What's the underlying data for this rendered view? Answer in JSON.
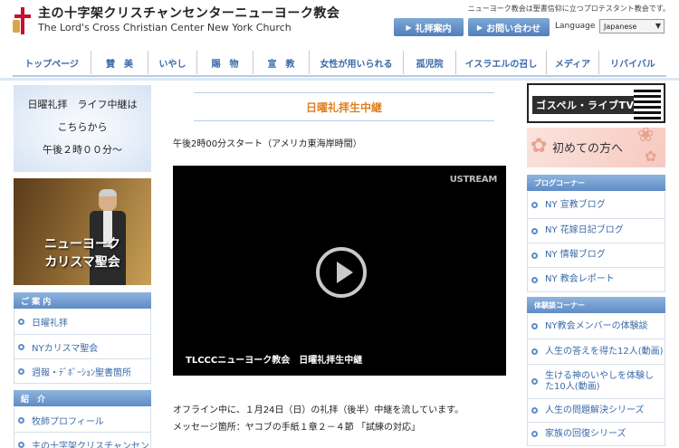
{
  "header": {
    "logo_jp": "主の十字架クリスチャンセンターニューヨーク教会",
    "logo_en": "The Lord's Cross Christian Center New York Church",
    "tagline": "ニューヨーク教会は聖書信仰に立つプロテスタント教会です。",
    "btn_worship": "礼拝案内",
    "btn_contact": "お問い合わせ",
    "language_label": "Language",
    "language_value": "Japanese",
    "arrow_icon": "▶"
  },
  "nav": {
    "items": [
      {
        "label": "トップページ"
      },
      {
        "label": "賛　美"
      },
      {
        "label": "いやし"
      },
      {
        "label": "賜　物"
      },
      {
        "label": "宣　教"
      },
      {
        "label": "女性が用いられる"
      },
      {
        "label": "孤児院"
      },
      {
        "label": "イスラエルの召し"
      },
      {
        "label": "メディア"
      },
      {
        "label": "リバイバル"
      }
    ]
  },
  "left": {
    "broadcast_lines": [
      "日曜礼拝　ライフ中継は",
      "こちらから",
      "午後２時００分～"
    ],
    "photo_caption_1": "ニューヨーク",
    "photo_caption_2": "カリスマ聖会",
    "guide_head": "ご 案 内",
    "guide_items": [
      {
        "label": "日曜礼拝"
      },
      {
        "label": "NYカリスマ聖会"
      },
      {
        "label": "週報・ﾃﾞﾎﾞｰｼｮﾝ聖書箇所"
      }
    ],
    "intro_head": "紹　介",
    "intro_items": [
      {
        "label": "牧師プロフィール"
      },
      {
        "label": "主の十字架クリスチャンセン"
      }
    ]
  },
  "main": {
    "title": "日曜礼拝生中継",
    "start_text": "午後2時00分スタート（アメリカ東海岸時間）",
    "video_brand": "USTREAM",
    "video_caption": "TLCCCニューヨーク教会　日曜礼拝生中継",
    "body_line_1": "オフライン中に、１月24日（日）の礼拝（後半）中継を流しています。",
    "body_line_2": "メッセージ箇所：ヤコブの手紙１章２－４節 「試練の対応」"
  },
  "right": {
    "gospel_banner": "ゴスペル・ライブTV",
    "first_banner": "初めての方へ",
    "blog_head": "ブログコーナー",
    "blog_items": [
      {
        "label": "NY 宣教ブログ"
      },
      {
        "label": "NY 花嫁日記ブログ"
      },
      {
        "label": "NY 情報ブログ"
      },
      {
        "label": "NY 教会レポート"
      }
    ],
    "exp_head": "体験談コーナー",
    "exp_items": [
      {
        "label": "NY教会メンバーの体験談"
      },
      {
        "label": "人生の答えを得た12人(動画)"
      },
      {
        "label": "生ける神のいやしを体験した10人(動画)"
      },
      {
        "label": "人生の問題解決シリーズ"
      },
      {
        "label": "家族の回復シリーズ"
      }
    ]
  },
  "colors": {
    "accent": "#3b6aa8",
    "title_orange": "#e08020",
    "section_blue": "#5f8cc6"
  }
}
